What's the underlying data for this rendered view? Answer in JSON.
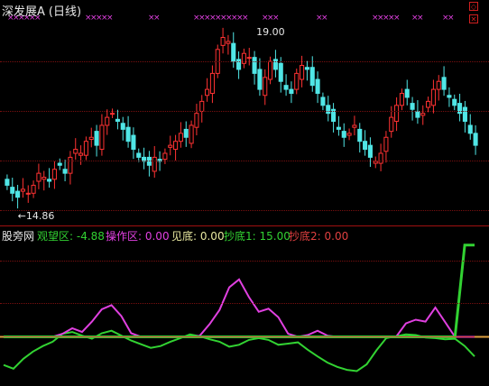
{
  "title": {
    "name": "深发展A",
    "period": "(日线)"
  },
  "price_markers": {
    "high": "19.00",
    "low": "←14.86"
  },
  "indicator_legend": [
    {
      "text": "股旁网",
      "color": "#e8e8e8"
    },
    {
      "text": "观望区: -4.88",
      "color": "#32d232"
    },
    {
      "text": "操作区: 0.00",
      "color": "#e040e0"
    },
    {
      "text": "见底: 0.00",
      "color": "#e8e8a0"
    },
    {
      "text": "抄底1: 15.00",
      "color": "#32d232"
    },
    {
      "text": "抄底2: 0.00",
      "color": "#e04040"
    }
  ],
  "signal_marker_symbol": "×",
  "colors": {
    "up_candle": "#ff3232",
    "down_candle": "#50e6e6",
    "signal_marker": "#e040e0",
    "watch_line": "#32d232",
    "operate_line": "#e040e0",
    "bottom_line": "#e0a040",
    "grid": "#7a1010"
  },
  "icons": [
    "restore-icon",
    "close-icon"
  ],
  "chart_data": [
    {
      "type": "candlestick",
      "title": "深发展A (日线)",
      "y_range": [
        14.6,
        19.25
      ],
      "annotations": [
        {
          "text": "19.00",
          "at": "high"
        },
        {
          "text": "←14.86",
          "at": "low"
        }
      ],
      "close_series": [
        15.2,
        15.0,
        14.9,
        15.1,
        15.0,
        15.2,
        15.5,
        15.4,
        15.3,
        15.6,
        15.7,
        15.5,
        15.9,
        16.1,
        16.0,
        16.3,
        16.4,
        16.2,
        16.7,
        16.9,
        17.0,
        16.8,
        16.6,
        16.3,
        16.1,
        15.9,
        15.8,
        15.7,
        15.9,
        15.8,
        16.0,
        16.2,
        16.3,
        16.5,
        16.4,
        16.7,
        17.0,
        17.3,
        17.6,
        18.0,
        18.6,
        18.9,
        18.8,
        18.3,
        18.1,
        18.5,
        18.4,
        18.0,
        17.6,
        17.9,
        18.3,
        18.1,
        17.8,
        17.6,
        17.5,
        18.0,
        18.2,
        18.1,
        17.7,
        17.5,
        17.2,
        17.0,
        16.8,
        16.6,
        16.4,
        16.5,
        16.7,
        16.3,
        16.1,
        15.9,
        15.8,
        16.0,
        16.4,
        16.9,
        17.2,
        17.5,
        17.4,
        17.1,
        16.9,
        17.0,
        17.3,
        17.6,
        17.8,
        17.6,
        17.4,
        17.2,
        17.0,
        16.8,
        16.5,
        16.2
      ],
      "signal_marker_groups": 12
    },
    {
      "type": "line",
      "title": "",
      "series": [
        {
          "name": "观望区",
          "color": "#32d232",
          "values": [
            -4.6,
            -5.2,
            -3.6,
            -2.4,
            -1.5,
            -0.8,
            0.5,
            0.8,
            0.2,
            -0.3,
            0.6,
            1.0,
            0.2,
            -0.6,
            -1.2,
            -1.8,
            -1.5,
            -0.8,
            -0.2,
            0.4,
            0.1,
            -0.4,
            -0.8,
            -1.6,
            -1.3,
            -0.5,
            -0.2,
            -0.5,
            -1.3,
            -1.1,
            -0.9,
            -2.1,
            -3.2,
            -4.2,
            -4.9,
            -5.4,
            -5.6,
            -4.5,
            -2.2,
            -0.2,
            0.1,
            0.4,
            0.3,
            -0.1,
            -0.2,
            -0.4,
            -0.3,
            -1.5,
            -3.2
          ]
        },
        {
          "name": "操作区",
          "color": "#e040e0",
          "values": [
            0,
            0,
            0,
            0,
            0,
            0,
            0.5,
            1.4,
            0.8,
            2.5,
            4.5,
            5.2,
            3.4,
            0.6,
            0,
            0,
            0,
            0,
            0,
            0,
            0.2,
            2.1,
            4.4,
            8.1,
            9.4,
            6.5,
            4.1,
            4.6,
            3.2,
            0.5,
            0,
            0.3,
            1.0,
            0.2,
            0,
            0,
            0,
            0,
            0,
            0,
            0,
            2.2,
            2.8,
            2.5,
            4.8,
            2.4,
            0,
            0,
            0
          ]
        },
        {
          "name": "见底",
          "color": "#e0a040",
          "values": [
            0,
            0,
            0,
            0,
            0,
            0,
            0,
            0,
            0,
            0,
            0,
            0,
            0,
            0,
            0,
            0,
            0,
            0,
            0,
            0,
            0,
            0,
            0,
            0,
            0,
            0,
            0,
            0,
            0,
            0,
            0,
            0,
            0,
            0,
            0,
            0,
            0,
            0,
            0,
            0,
            0,
            0,
            0,
            0,
            0,
            0,
            0,
            0,
            0
          ]
        },
        {
          "name": "抄底1",
          "color": "#32d232",
          "values": [
            0,
            0,
            0,
            0,
            0,
            0,
            0,
            0,
            0,
            0,
            0,
            0,
            0,
            0,
            0,
            0,
            0,
            0,
            0,
            0,
            0,
            0,
            0,
            0,
            0,
            0,
            0,
            0,
            0,
            0,
            0,
            0,
            0,
            0,
            0,
            0,
            0,
            0,
            0,
            0,
            0,
            0,
            0,
            0,
            0,
            0,
            0,
            15,
            15
          ]
        },
        {
          "name": "抄底2",
          "color": "#e04040",
          "values": [
            0,
            0,
            0,
            0,
            0,
            0,
            0,
            0,
            0,
            0,
            0,
            0,
            0,
            0,
            0,
            0,
            0,
            0,
            0,
            0,
            0,
            0,
            0,
            0,
            0,
            0,
            0,
            0,
            0,
            0,
            0,
            0,
            0,
            0,
            0,
            0,
            0,
            0,
            0,
            0,
            0,
            0,
            0,
            0,
            0,
            0,
            0,
            0,
            0
          ]
        }
      ],
      "y_range": [
        -7,
        16
      ]
    }
  ]
}
